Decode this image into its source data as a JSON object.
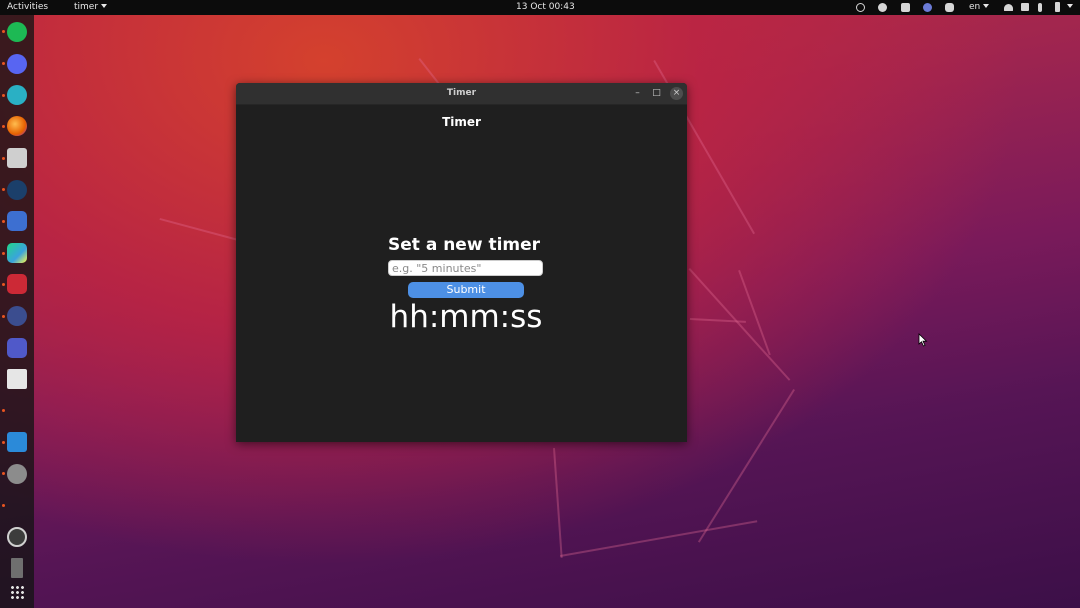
{
  "topbar": {
    "activities": "Activities",
    "app_menu": "timer",
    "clock": "13 Oct  00:43",
    "language": "en"
  },
  "tray_icons": [
    "update-icon",
    "steam-tray-icon",
    "screenshot-icon",
    "network-activity-icon",
    "discord-tray-icon",
    "wifi-icon",
    "speaker-icon",
    "microphone-icon",
    "battery-icon"
  ],
  "dock": {
    "apps": [
      {
        "name": "spotify",
        "color": "#1db954"
      },
      {
        "name": "discord",
        "color": "#5865f2"
      },
      {
        "name": "mail",
        "color": "#2ab0c4"
      },
      {
        "name": "firefox",
        "color": "#e66000"
      },
      {
        "name": "files",
        "color": "#cfcfcf"
      },
      {
        "name": "steam",
        "color": "#1b3f6a"
      },
      {
        "name": "screenshot-tool",
        "color": "#3d6fd1"
      },
      {
        "name": "pycharm",
        "color": "#3aa3dd"
      },
      {
        "name": "zotero",
        "color": "#cc2936"
      },
      {
        "name": "keepass",
        "color": "#3b4d8f"
      },
      {
        "name": "teams",
        "color": "#5059c9"
      },
      {
        "name": "calendar",
        "color": "#e6e6e6"
      },
      {
        "name": "vscode",
        "color": "#2b8ad9"
      },
      {
        "name": "settings",
        "color": "#8c8c8c"
      },
      {
        "name": "obs",
        "color": "#3c3c3c"
      },
      {
        "name": "trash",
        "color": "#6f6f6f"
      }
    ],
    "show_apps_icon": "grid-icon"
  },
  "window": {
    "title": "Timer",
    "controls": {
      "minimize": "–",
      "maximize": "□",
      "close": "×"
    }
  },
  "app": {
    "heading": "Timer",
    "form_title": "Set a new timer",
    "input_placeholder": "e.g. \"5 minutes\"",
    "input_value": "",
    "submit_label": "Submit",
    "time_display": "hh:mm:ss"
  },
  "colors": {
    "accent_button": "#4d90e5",
    "window_background": "#1f1f1f",
    "ubuntu_orange": "#e95420"
  }
}
